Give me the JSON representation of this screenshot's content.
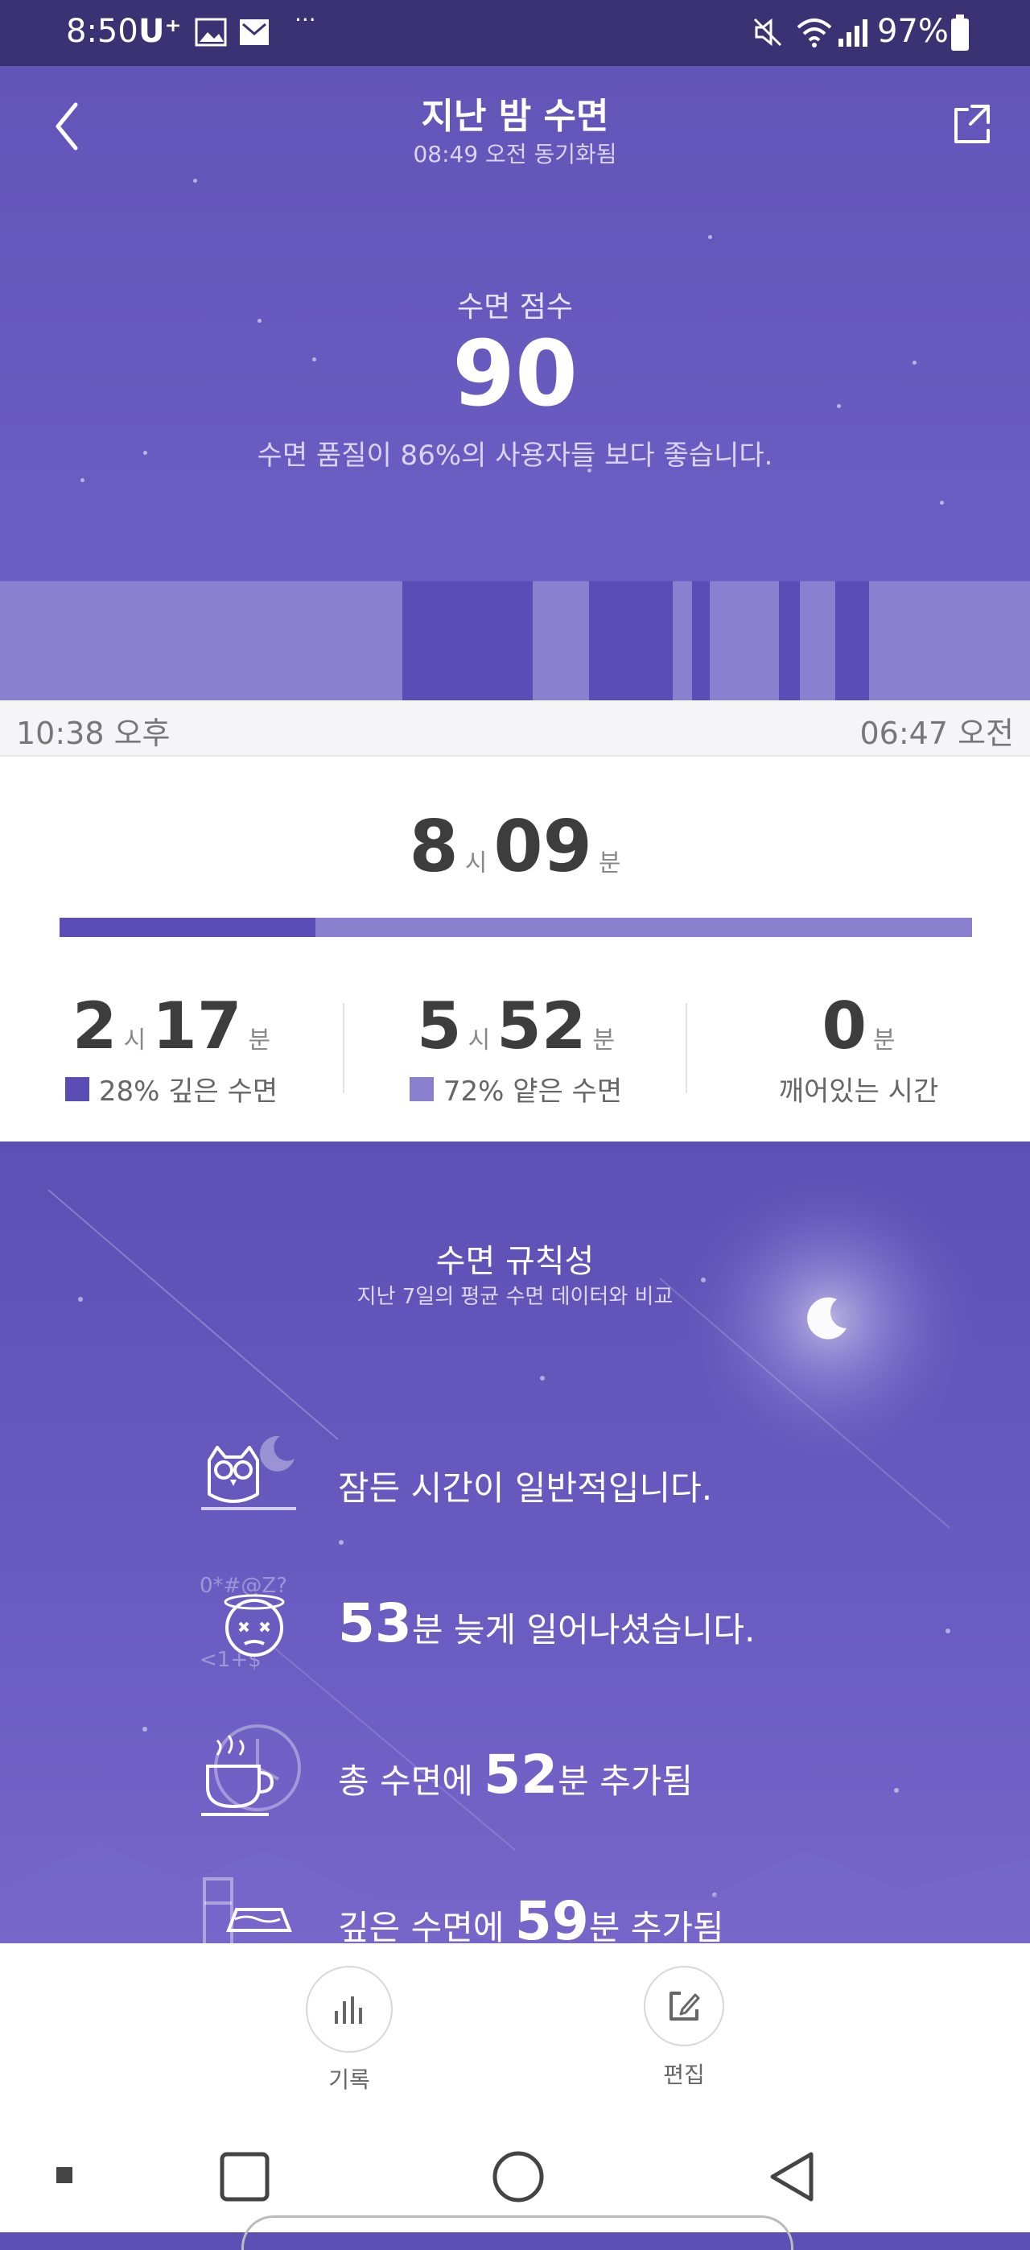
{
  "status_bar": {
    "time": "8:50",
    "carrier": "U⁺",
    "battery": "97%"
  },
  "header": {
    "title": "지난 밤 수면",
    "subtitle": "08:49 오전 동기화됨"
  },
  "score": {
    "label": "수면 점수",
    "value": "90",
    "description": "수면 품질이 86%의 사용자들 보다 좋습니다."
  },
  "timeline": {
    "start_label": "10:38 오후",
    "end_label": "06:47 오전"
  },
  "total": {
    "hours": "8",
    "hours_unit": "시",
    "minutes": "09",
    "minutes_unit": "분",
    "deep_fraction": 0.28
  },
  "breakdown": {
    "deep": {
      "hours": "2",
      "hours_unit": "시",
      "minutes": "17",
      "minutes_unit": "분",
      "label": "28% 깊은 수면"
    },
    "light": {
      "hours": "5",
      "hours_unit": "시",
      "minutes": "52",
      "minutes_unit": "분",
      "label": "72% 얕은 수면"
    },
    "awake": {
      "minutes": "0",
      "minutes_unit": "분",
      "label": "깨어있는 시간"
    }
  },
  "regularity": {
    "title": "수면 규칙성",
    "subtitle": "지난 7일의 평균 수면 데이터와 비교",
    "rows": [
      {
        "prefix": "",
        "num": "",
        "suffix": "잠든 시간이 일반적입니다."
      },
      {
        "prefix": "",
        "num": "53",
        "suffix": "분 늦게 일어나셨습니다."
      },
      {
        "prefix": "총 수면에 ",
        "num": "52",
        "suffix": "분 추가됨"
      },
      {
        "prefix": "깊은 수면에 ",
        "num": "59",
        "suffix": "분 추가됨"
      }
    ]
  },
  "bottom_bar": {
    "history_label": "기록",
    "edit_label": "편집"
  },
  "colors": {
    "deep": "#5b4db5",
    "light": "#8a80cf",
    "hero": "#6354b8",
    "status_bar": "#3a3272"
  }
}
